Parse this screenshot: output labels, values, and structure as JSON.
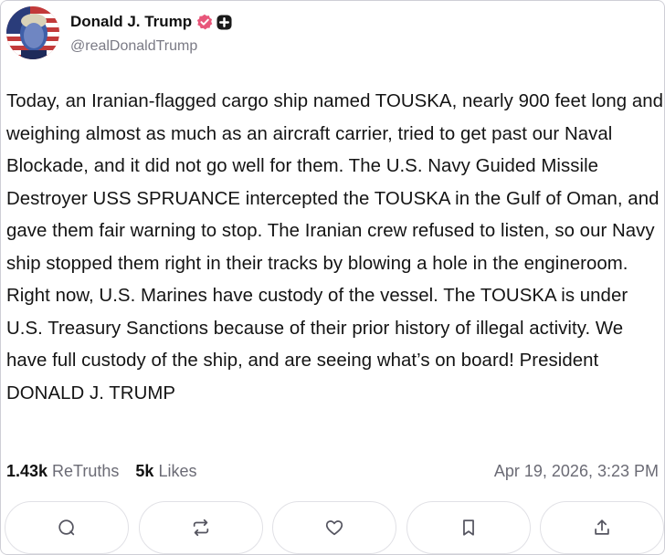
{
  "author": {
    "display_name": "Donald J. Trump",
    "handle": "@realDonaldTrump",
    "avatar_icon": "avatar-portrait-icon",
    "verified_icon": "verified-check-icon",
    "badge_icon": "plus-badge-icon",
    "verified_color": "#e8567a"
  },
  "post": {
    "text": "Today, an Iranian-flagged cargo ship named TOUSKA, nearly 900 feet long and weighing almost as much as an aircraft carrier, tried to get past our Naval Blockade, and it did not go well for them. The U.S. Navy Guided Missile Destroyer USS SPRUANCE intercepted the TOUSKA in the Gulf of Oman, and gave them fair warning to stop. The Iranian crew refused to listen, so our Navy ship stopped them right in their tracks by blowing a hole in the engineroom. Right now, U.S. Marines have custody of the vessel. The TOUSKA is under U.S. Treasury Sanctions because of their prior history of illegal activity. We have full custody of the ship, and are seeing what’s on board! President DONALD J. TRUMP"
  },
  "stats": {
    "retruths_count": "1.43k",
    "retruths_label": "ReTruths",
    "likes_count": "5k",
    "likes_label": "Likes",
    "timestamp": "Apr 19, 2026, 3:23 PM"
  },
  "actions": [
    {
      "icon": "reply-icon"
    },
    {
      "icon": "retruth-icon"
    },
    {
      "icon": "like-heart-icon"
    },
    {
      "icon": "bookmark-icon"
    },
    {
      "icon": "share-icon"
    }
  ]
}
